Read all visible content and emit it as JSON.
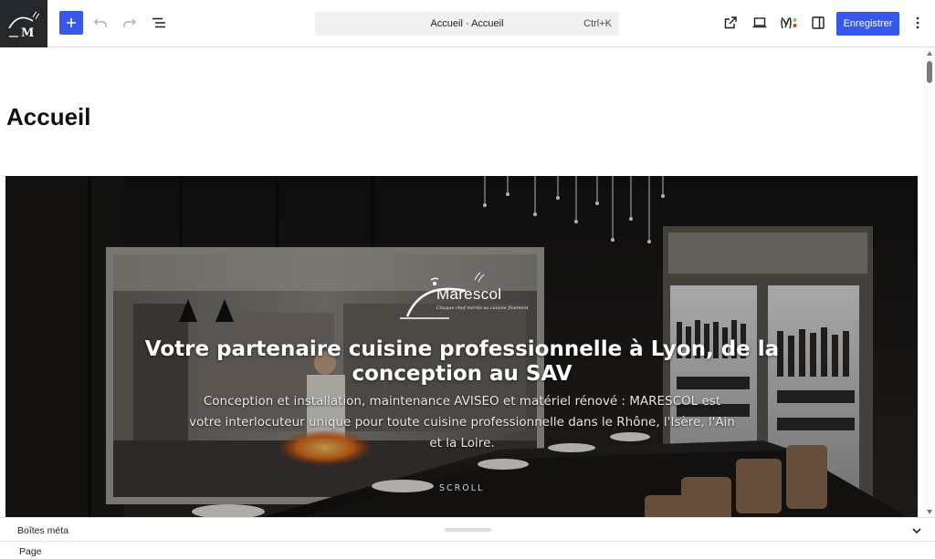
{
  "toolbar": {
    "site_logo_icon": "marescol-site-icon",
    "add_icon": "plus-icon",
    "undo_icon": "undo-icon",
    "redo_icon": "redo-icon",
    "list_view_icon": "list-view-icon",
    "command_center": {
      "label": "Accueil · Accueil",
      "shortcut": "Ctrl+K"
    },
    "view_icon": "external-link-icon",
    "device_icon": "laptop-preview-icon",
    "yoast_icon": "yoast-seo-icon",
    "settings_icon": "sidebar-settings-icon",
    "save_label": "Enregistrer",
    "options_icon": "more-vertical-icon",
    "accent_color": "#3858e9"
  },
  "canvas": {
    "page_title": "Accueil",
    "hero": {
      "logo_name": "Marescol",
      "logo_tagline": "Chaque chef mérite sa cuisine finement",
      "heading": "Votre partenaire cuisine professionnelle à Lyon, de la conception au SAV",
      "subtext": "Conception et installation, maintenance AVISEO et matériel rénové : MARESCOL est votre interlocuteur unique pour toute cuisine professionnelle dans le Rhône, l'Isère, l'Ain et la Loire.",
      "scroll_label": "SCROLL"
    }
  },
  "meta_panel": {
    "label": "Boîtes méta",
    "chevron_icon": "chevron-down-icon"
  },
  "footer": {
    "breadcrumb": "Page"
  }
}
